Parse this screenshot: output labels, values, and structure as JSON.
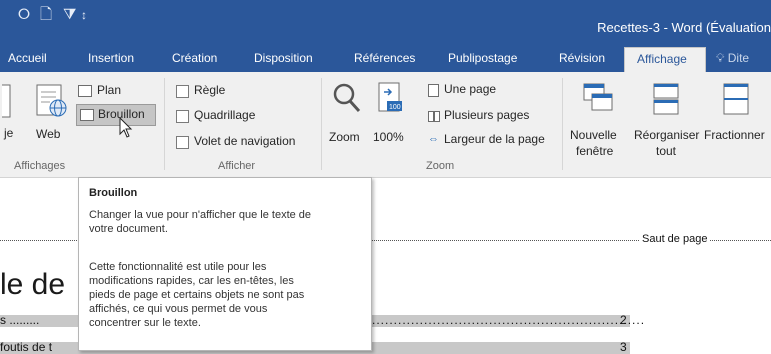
{
  "window": {
    "title": "Recettes-3 - Word (Évaluation",
    "quick_access": [
      "save-icon",
      "new-document-icon",
      "customize-icon"
    ]
  },
  "tabs": [
    "Accueil",
    "Insertion",
    "Création",
    "Disposition",
    "Références",
    "Publipostage",
    "Révision",
    "Affichage"
  ],
  "active_tab": "Affichage",
  "tell_me": "Dite",
  "colors": {
    "brand": "#2b579a",
    "ribbon": "#f0f0f0",
    "highlight": "#c5c5c5"
  },
  "ribbon": {
    "views": {
      "partial_label": "je",
      "web_label": "Web",
      "plan_label": "Plan",
      "brouillon_label": "Brouillon",
      "group_label": "Affichages"
    },
    "show": {
      "items": [
        {
          "label": "Règle",
          "checked": false
        },
        {
          "label": "Quadrillage",
          "checked": false
        },
        {
          "label": "Volet de navigation",
          "checked": false
        }
      ],
      "group_label": "Afficher"
    },
    "zoom": {
      "zoom_label": "Zoom",
      "percent_label": "100%",
      "one_page": "Une page",
      "multiple_pages": "Plusieurs pages",
      "page_width": "Largeur de la page",
      "group_label": "Zoom"
    },
    "window": {
      "new_window": [
        "Nouvelle",
        "fenêtre"
      ],
      "arrange_all": [
        "Réorganiser",
        "tout"
      ],
      "split": "Fractionner"
    }
  },
  "tooltip": {
    "title": "Brouillon",
    "lines1": [
      "Changer la vue pour n'afficher que le texte de",
      "votre document."
    ],
    "lines2": [
      "Cette fonctionnalité est utile pour les",
      "modifications rapides, car les en-têtes, les",
      "pieds de page et certains objets ne sont pas",
      "affichés, ce qui vous permet de vous",
      "concentrer sur le texte."
    ]
  },
  "document": {
    "page_break": "Saut de page",
    "heading_fragment": "le de",
    "toc": [
      {
        "left": "s .........",
        "page": "2"
      },
      {
        "left": "foutis de t",
        "page": "3"
      }
    ]
  }
}
